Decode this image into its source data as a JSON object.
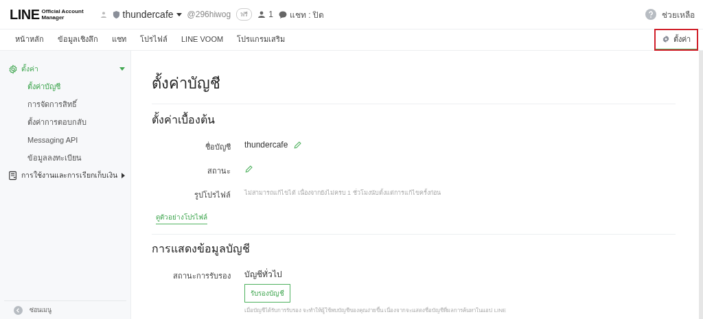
{
  "header": {
    "logo_main": "LINE",
    "logo_sub_1": "Official Account",
    "logo_sub_2": "Manager",
    "account_name": "thundercafe",
    "account_id": "@296hiwog",
    "plan_badge": "ฟรี",
    "followers": "1",
    "chat_status": "แชท : ปิด",
    "help": "ช่วยเหลือ"
  },
  "nav_tabs": [
    {
      "label": "หน้าหลัก",
      "selected": false,
      "highlighted": false
    },
    {
      "label": "ข้อมูลเชิงลึก",
      "selected": false,
      "highlighted": false
    },
    {
      "label": "แชท",
      "selected": false,
      "highlighted": false
    },
    {
      "label": "โปรไฟล์",
      "selected": false,
      "highlighted": false
    },
    {
      "label": "LINE VOOM",
      "selected": false,
      "highlighted": false
    },
    {
      "label": "โปรแกรมเสริม",
      "selected": false,
      "highlighted": false
    }
  ],
  "settings_tab": {
    "label": "ตั้งค่า",
    "selected": true,
    "highlighted": true
  },
  "sidebar": {
    "groups": [
      {
        "label": "ตั้งค่า",
        "kind": "gear",
        "expanded": true,
        "active": true,
        "children": [
          {
            "label": "ตั้งค่าบัญชี",
            "selected": true
          },
          {
            "label": "การจัดการสิทธิ์",
            "selected": false
          },
          {
            "label": "ตั้งค่าการตอบกลับ",
            "selected": false
          },
          {
            "label": "Messaging API",
            "selected": false
          },
          {
            "label": "ข้อมูลลงทะเบียน",
            "selected": false
          }
        ]
      },
      {
        "label": "การใช้งานและการเรียกเก็บเงิน",
        "kind": "document",
        "expanded": false,
        "active": false
      }
    ],
    "hide_menu": "ซ่อนเมนู"
  },
  "page_title": "ตั้งค่าบัญชี",
  "sections": [
    {
      "title": "ตั้งค่าเบื้องต้น",
      "rows": [
        {
          "label": "ชื่อบัญชี",
          "value": "thundercafe",
          "editable": true
        },
        {
          "label": "สถานะ",
          "editable": true
        },
        {
          "label": "รูปโปรไฟล์",
          "note": "ไม่สามารถแก้ไขได้ เนื่องจากยังไม่ครบ 1 ชั่วโมงนับตั้งแต่การแก้ไขครั้งก่อน",
          "editable": false
        }
      ],
      "link": "ดูตัวอย่างโปรไฟล์"
    },
    {
      "title": "การแสดงข้อมูลบัญชี",
      "rows": [
        {
          "label": "สถานะการรับรอง",
          "value": "บัญชีทั่วไป",
          "button": "รับรองบัญชี",
          "note": "เมื่อบัญชีได้รับการรับรอง จะทำให้ผู้ใช้พบบัญชีของคุณง่ายขึ้น เนื่องจากจะแสดงชื่อบัญชีที่ผลการค้นหาในแอป LINE",
          "editable": false
        }
      ]
    }
  ]
}
